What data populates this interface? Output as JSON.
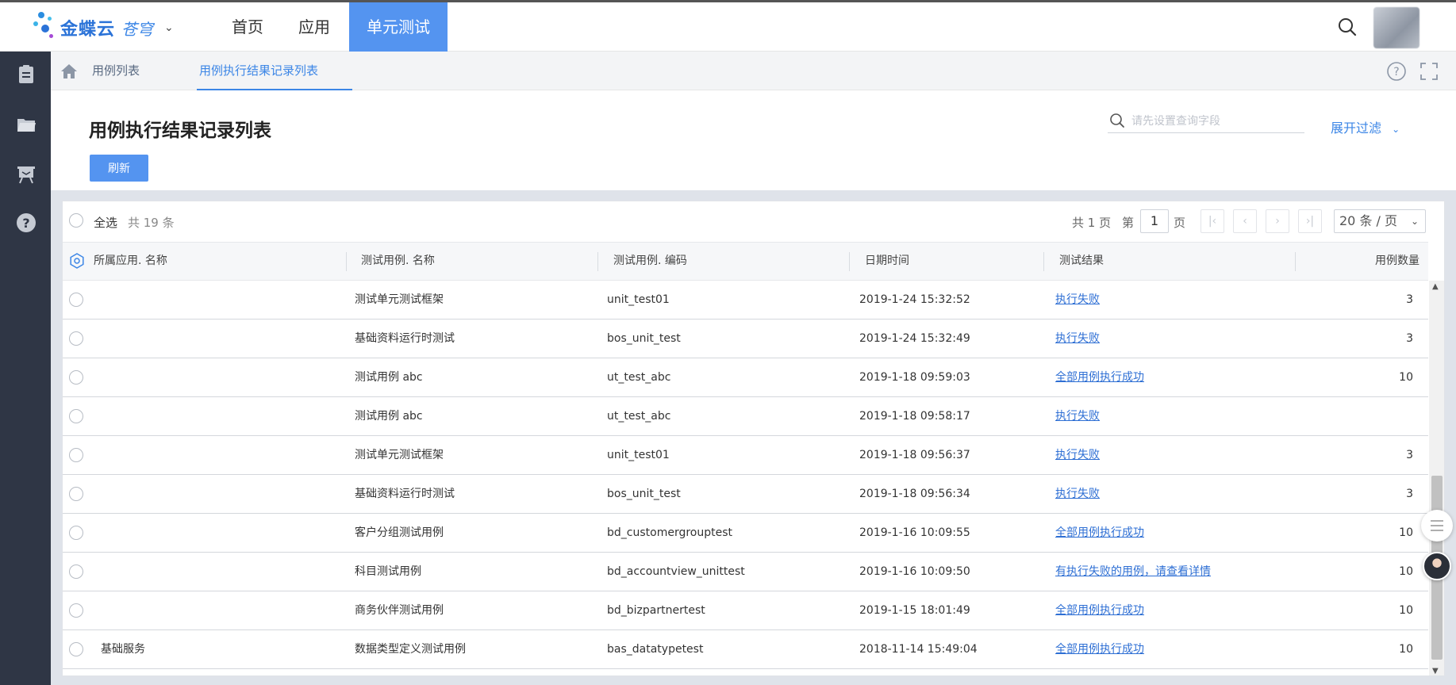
{
  "app": {
    "logo_text": "金蝶云",
    "logo_sub": "苍穹",
    "nav": [
      {
        "label": "首页"
      },
      {
        "label": "应用"
      },
      {
        "label": "单元测试",
        "active": true
      }
    ]
  },
  "breadcrumbs": [
    {
      "label": "用例列表"
    },
    {
      "label": "用例执行结果记录列表",
      "active": true
    }
  ],
  "header": {
    "title": "用例执行结果记录列表",
    "refresh_label": "刷新",
    "search_placeholder": "请先设置查询字段",
    "filter_label": "展开过滤"
  },
  "toolbar": {
    "select_all": "全选",
    "total": "共 19 条",
    "total_pages": "共 1 页",
    "page_prefix": "第",
    "page_current": "1",
    "page_suffix": "页",
    "page_size": "20 条 / 页"
  },
  "columns": [
    "所属应用. 名称",
    "测试用例. 名称",
    "测试用例. 编码",
    "日期时间",
    "测试结果",
    "用例数量"
  ],
  "rows": [
    {
      "app": "",
      "name": "测试单元测试框架",
      "code": "unit_test01",
      "datetime": "2019-1-24 15:32:52",
      "result": "执行失败",
      "count": "3"
    },
    {
      "app": "",
      "name": "基础资料运行时测试",
      "code": "bos_unit_test",
      "datetime": "2019-1-24 15:32:49",
      "result": "执行失败",
      "count": "3"
    },
    {
      "app": "",
      "name": "测试用例 abc",
      "code": "ut_test_abc",
      "datetime": "2019-1-18 09:59:03",
      "result": "全部用例执行成功",
      "count": "10"
    },
    {
      "app": "",
      "name": "测试用例 abc",
      "code": "ut_test_abc",
      "datetime": "2019-1-18 09:58:17",
      "result": "执行失败",
      "count": ""
    },
    {
      "app": "",
      "name": "测试单元测试框架",
      "code": "unit_test01",
      "datetime": "2019-1-18 09:56:37",
      "result": "执行失败",
      "count": "3"
    },
    {
      "app": "",
      "name": "基础资料运行时测试",
      "code": "bos_unit_test",
      "datetime": "2019-1-18 09:56:34",
      "result": "执行失败",
      "count": "3"
    },
    {
      "app": "",
      "name": "客户分组测试用例",
      "code": "bd_customergrouptest",
      "datetime": "2019-1-16 10:09:55",
      "result": "全部用例执行成功",
      "count": "10"
    },
    {
      "app": "",
      "name": "科目测试用例",
      "code": "bd_accountview_unittest",
      "datetime": "2019-1-16 10:09:50",
      "result": "有执行失败的用例，请查看详情",
      "count": "10"
    },
    {
      "app": "",
      "name": "商务伙伴测试用例",
      "code": "bd_bizpartnertest",
      "datetime": "2019-1-15 18:01:49",
      "result": "全部用例执行成功",
      "count": "10"
    },
    {
      "app": "基础服务",
      "name": "数据类型定义测试用例",
      "code": "bas_datatypetest",
      "datetime": "2018-11-14 15:49:04",
      "result": "全部用例执行成功",
      "count": "10"
    }
  ],
  "colors": {
    "accent": "#5494f0",
    "link": "#2e6fd4",
    "sidebar": "#2f3645"
  },
  "icons": {
    "sidebar": [
      "clipboard-icon",
      "folder-icon",
      "presentation-icon",
      "help-circle-icon"
    ],
    "top": [
      "search-icon",
      "user-avatar"
    ],
    "crumb_right": [
      "help-icon",
      "fullscreen-icon"
    ]
  }
}
